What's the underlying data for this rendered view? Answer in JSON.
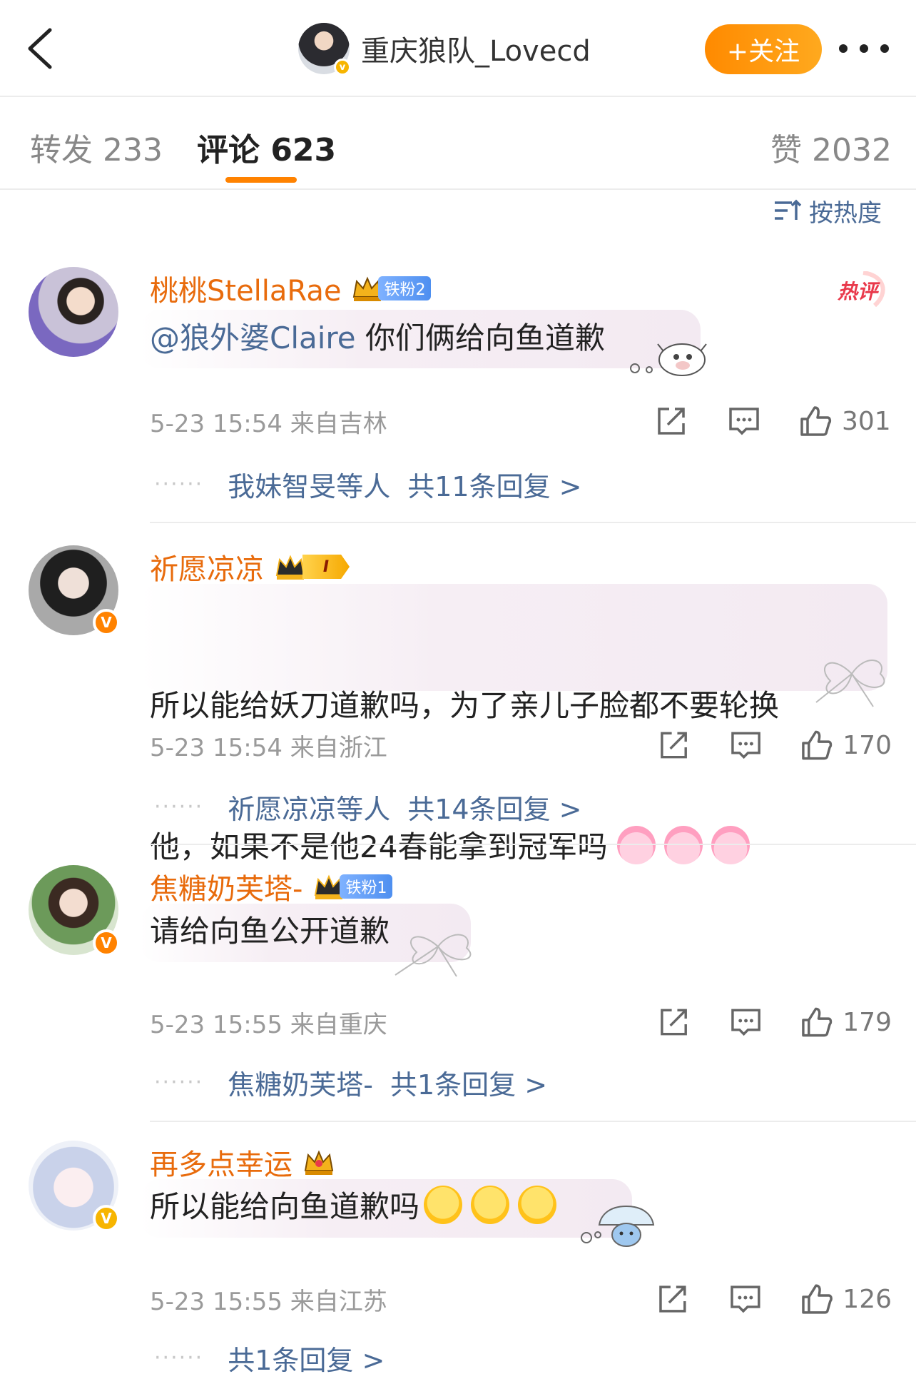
{
  "header": {
    "author_name": "重庆狼队_Lovecd",
    "follow_label": "+关注",
    "verified_mark": "v"
  },
  "tabs": [
    {
      "label": "转发 233"
    },
    {
      "label": "评论 623"
    },
    {
      "label": "赞 2032"
    }
  ],
  "sort": {
    "label": "按热度"
  },
  "hot_tag": "热评",
  "comments": [
    {
      "user": "桃桃StellaRae",
      "badge": "铁粉2",
      "mention": "@狼外婆Claire",
      "text": " 你们俩给向鱼道歉",
      "time": "5-23 15:54 来自吉林",
      "likes": "301",
      "dots": "······",
      "reply_users": "我妹智旻等人",
      "reply_total": "共11条回复 >"
    },
    {
      "user": "祈愿凉凉",
      "badge": "I",
      "text_line1": "所以能给妖刀道歉吗，为了亲儿子脸都不要轮换",
      "text_line2": "他，如果不是他24春能拿到冠军吗",
      "time": "5-23 15:54 来自浙江",
      "likes": "170",
      "dots": "······",
      "reply_users": "祈愿凉凉等人",
      "reply_total": "共14条回复 >"
    },
    {
      "user": "焦糖奶芙塔-",
      "badge": "铁粉1",
      "text": "请给向鱼公开道歉",
      "time": "5-23 15:55 来自重庆",
      "likes": "179",
      "dots": "······",
      "reply_users": "焦糖奶芙塔-",
      "reply_total": "共1条回复 >"
    },
    {
      "user": "再多点幸运",
      "text": "所以能给向鱼道歉吗",
      "time": "5-23 15:55 来自江苏",
      "likes": "126",
      "dots": "······",
      "reply_total": "共1条回复 >"
    }
  ],
  "colors": {
    "accent_orange": "#ff8200",
    "username_orange": "#e86b0c",
    "link_blue": "#4a6a96",
    "meta_gray": "#9a9a9a"
  }
}
